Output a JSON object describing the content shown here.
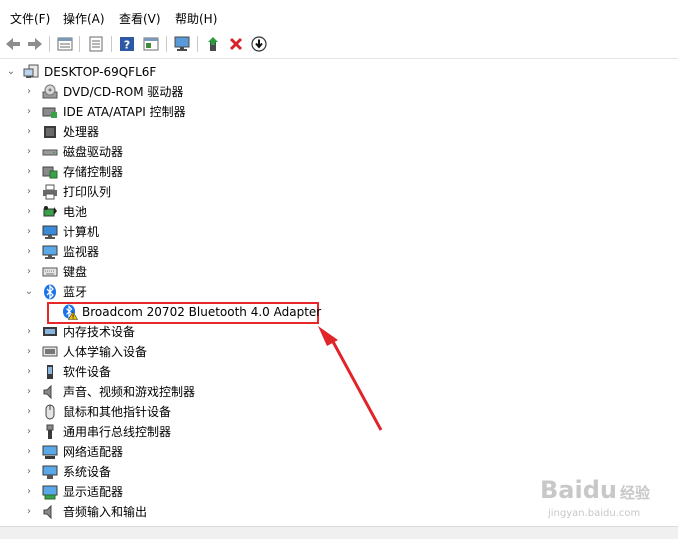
{
  "menu": [
    "文件(F)",
    "操作(A)",
    "查看(V)",
    "帮助(H)"
  ],
  "toolbar": {
    "icons": [
      "back-arrow-icon",
      "forward-arrow-icon",
      "properties-icon",
      "list-view-icon",
      "help-icon",
      "details-pane-icon",
      "monitor-scan-icon",
      "update-driver-icon",
      "uninstall-icon",
      "download-icon"
    ]
  },
  "tree": {
    "root": "DESKTOP-69QFL6F",
    "items": [
      {
        "label": "DVD/CD-ROM 驱动器",
        "icon": "dvd-drive-icon"
      },
      {
        "label": "IDE ATA/ATAPI 控制器",
        "icon": "ide-controller-icon"
      },
      {
        "label": "处理器",
        "icon": "processor-icon"
      },
      {
        "label": "磁盘驱动器",
        "icon": "disk-drive-icon"
      },
      {
        "label": "存储控制器",
        "icon": "storage-controller-icon"
      },
      {
        "label": "打印队列",
        "icon": "printer-icon"
      },
      {
        "label": "电池",
        "icon": "battery-icon"
      },
      {
        "label": "计算机",
        "icon": "computer-icon"
      },
      {
        "label": "监视器",
        "icon": "monitor-icon"
      },
      {
        "label": "键盘",
        "icon": "keyboard-icon"
      },
      {
        "label": "蓝牙",
        "icon": "bluetooth-icon",
        "expanded": true
      },
      {
        "label": "Broadcom 20702 Bluetooth 4.0 Adapter",
        "icon": "bluetooth-warning-icon",
        "child": true
      },
      {
        "label": "内存技术设备",
        "icon": "memory-device-icon"
      },
      {
        "label": "人体学输入设备",
        "icon": "hid-icon"
      },
      {
        "label": "软件设备",
        "icon": "software-device-icon"
      },
      {
        "label": "声音、视频和游戏控制器",
        "icon": "speaker-icon"
      },
      {
        "label": "鼠标和其他指针设备",
        "icon": "mouse-icon"
      },
      {
        "label": "通用串行总线控制器",
        "icon": "usb-icon"
      },
      {
        "label": "网络适配器",
        "icon": "network-adapter-icon"
      },
      {
        "label": "系统设备",
        "icon": "system-device-icon"
      },
      {
        "label": "显示适配器",
        "icon": "display-adapter-icon"
      },
      {
        "label": "音频输入和输出",
        "icon": "audio-io-icon"
      }
    ]
  },
  "watermark": {
    "brand": "Baidu",
    "tag": "经验",
    "url": "jingyan.baidu.com"
  },
  "colors": {
    "highlight": "#e8272a",
    "arrow": "#e0242a",
    "bluetooth": "#1a73e8"
  }
}
